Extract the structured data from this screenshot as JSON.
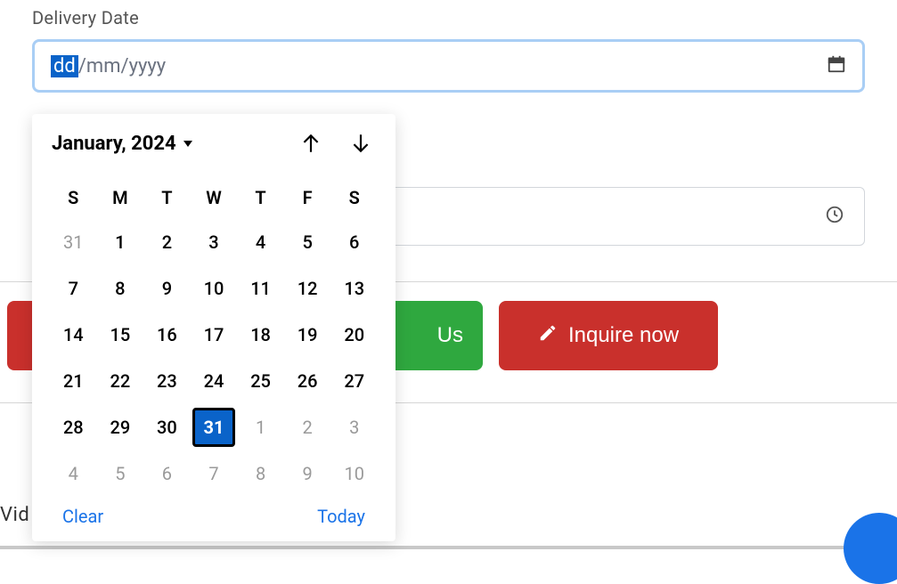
{
  "field_label": "Delivery Date",
  "date_input": {
    "dd": "dd",
    "sep1": "/",
    "mm": "mm",
    "sep2": "/",
    "yyyy": "yyyy"
  },
  "calendar": {
    "month_year": "January, 2024",
    "day_abbrev": [
      "S",
      "M",
      "T",
      "W",
      "T",
      "F",
      "S"
    ],
    "weeks": [
      [
        {
          "d": "31",
          "muted": true
        },
        {
          "d": "1"
        },
        {
          "d": "2"
        },
        {
          "d": "3"
        },
        {
          "d": "4"
        },
        {
          "d": "5"
        },
        {
          "d": "6"
        }
      ],
      [
        {
          "d": "7"
        },
        {
          "d": "8"
        },
        {
          "d": "9"
        },
        {
          "d": "10"
        },
        {
          "d": "11"
        },
        {
          "d": "12"
        },
        {
          "d": "13"
        }
      ],
      [
        {
          "d": "14"
        },
        {
          "d": "15"
        },
        {
          "d": "16"
        },
        {
          "d": "17"
        },
        {
          "d": "18"
        },
        {
          "d": "19"
        },
        {
          "d": "20"
        }
      ],
      [
        {
          "d": "21"
        },
        {
          "d": "22"
        },
        {
          "d": "23"
        },
        {
          "d": "24"
        },
        {
          "d": "25"
        },
        {
          "d": "26"
        },
        {
          "d": "27"
        }
      ],
      [
        {
          "d": "28"
        },
        {
          "d": "29"
        },
        {
          "d": "30"
        },
        {
          "d": "31",
          "selected": true
        },
        {
          "d": "1",
          "muted": true
        },
        {
          "d": "2",
          "muted": true
        },
        {
          "d": "3",
          "muted": true
        }
      ],
      [
        {
          "d": "4",
          "muted": true
        },
        {
          "d": "5",
          "muted": true
        },
        {
          "d": "6",
          "muted": true
        },
        {
          "d": "7",
          "muted": true
        },
        {
          "d": "8",
          "muted": true
        },
        {
          "d": "9",
          "muted": true
        },
        {
          "d": "10",
          "muted": true
        }
      ]
    ],
    "clear_label": "Clear",
    "today_label": "Today"
  },
  "buttons": {
    "call_partial": "Us",
    "inquire": "Inquire now"
  },
  "partial_text": "Vid"
}
